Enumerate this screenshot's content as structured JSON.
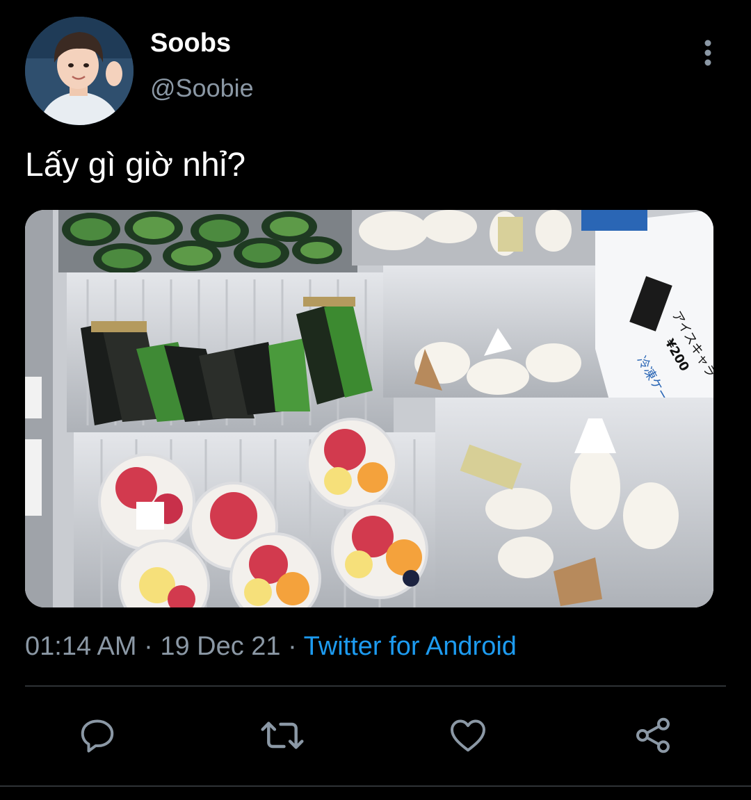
{
  "author": {
    "display_name": "Soobs",
    "handle": "@Soobie"
  },
  "tweet": {
    "text": "Lấy gì giờ nhỉ?"
  },
  "meta": {
    "time": "01:14 AM",
    "separator": "·",
    "date": "19 Dec 21",
    "source": "Twitter for Android"
  },
  "actions": [
    {
      "name": "reply",
      "icon": "reply-icon"
    },
    {
      "name": "retweet",
      "icon": "retweet-icon"
    },
    {
      "name": "like",
      "icon": "heart-icon"
    },
    {
      "name": "share",
      "icon": "share-icon"
    }
  ],
  "photo": {
    "sign_text_1": "アイスキャラ",
    "sign_price": "¥200",
    "sign_text_2": "冷凍ケースにある"
  },
  "colors": {
    "background": "#000000",
    "primary_text": "#ffffff",
    "secondary_text": "#8b98a5",
    "link": "#1d9bf0",
    "divider": "#2f3336",
    "icon": "#8b98a5"
  }
}
